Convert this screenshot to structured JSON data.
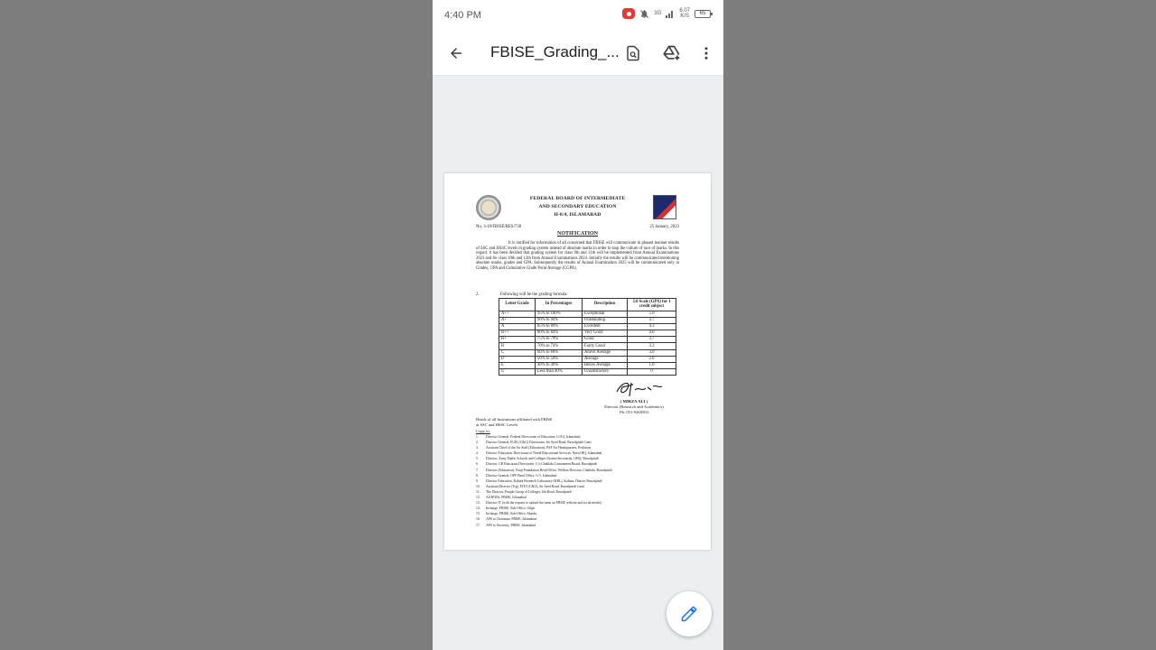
{
  "status_bar": {
    "time": "4:40 PM",
    "network": "3G",
    "speed_value": "6.07",
    "speed_unit": "K/S",
    "battery": "65"
  },
  "toolbar": {
    "title": "FBISE_Grading_...",
    "icons": [
      "back-arrow-icon",
      "find-in-page-icon",
      "drive-add-icon",
      "more-vert-icon"
    ]
  },
  "document": {
    "header_lines": [
      "FEDERAL BOARD OF INTERMEDIATE",
      "AND SECONDARY EDUCATION",
      "H-8/4, ISLAMABAD"
    ],
    "ref_no": "No. 3-19/FBISE/RES/738",
    "date": "25 January, 2023",
    "heading": "NOTIFICATION",
    "paragraph1": "It is notified for information of all concerned that FBISE will communicate in phased manner results of SSC and HSSC levels in grading system instead of absolute marks in order to stop the culture of race of marks. In this regard, it has been decided that grading system for class 9th and 11th will be implemented from Annual Examinations 2023 and for class 10th and 12th from Annual Examinations 2024. Initially the results will be communicated mentioning absolute marks, grades and GPA. Subsequently the results of Annual Examination 2025 will be communicated only in Grades, GPA and Cumulative Grade Point Average (CGPA).",
    "paragraph2_num": "2.",
    "paragraph2": "Following will be the grading formula:",
    "table": {
      "headers": [
        "Letter Grade",
        "In Percentages",
        "Description",
        "5.0 Scale (GPA) for 1 credit subject"
      ],
      "rows": [
        [
          "A++",
          "95% to 100%",
          "Exceptional",
          "5.0"
        ],
        [
          "A+",
          "90% to 94%",
          "Outstanding",
          "4.7"
        ],
        [
          "A",
          "85% to 89%",
          "Excellent",
          "4.3"
        ],
        [
          "B++",
          "80% to 84%",
          "Very Good",
          "4.0"
        ],
        [
          "B+",
          "75% to 79%",
          "Good",
          "3.7"
        ],
        [
          "B",
          "70% to 74%",
          "Fairly Good",
          "3.3"
        ],
        [
          "C",
          "60% to 69%",
          "Above Average",
          "3.0"
        ],
        [
          "D",
          "50% to 59%",
          "Average",
          "2.0"
        ],
        [
          "E",
          "40% to 49%",
          "Below Average",
          "1.0"
        ],
        [
          "U",
          "Less than 40%",
          "Unsatisfactory",
          "0"
        ]
      ]
    },
    "signatory_name": "( MIRZA ALI )",
    "signatory_designation": "Director (Research and Academics)",
    "signatory_phone": "Ph: 051-9269504",
    "addressee_line1": "Heads of all Institutions affiliated with FBISE",
    "addressee_line2": "at SSC and HSSC Levels",
    "copy_to_label": "Copy to:",
    "copy_to": [
      "Director General, Federal Directorate of Education, G-9/4, Islamabad",
      "Director General, FGEI (C&G) Directorate, Sir Syed Road, Rawalpindi Cantt",
      "Assistant Chief of the Air Staff (Education), PAF Air Headquarters, Peshawar",
      "Director Education, Directorate of Naval Educational Services, Naval HQ, Islamabad",
      "Director, Army Public Schools and Colleges System Secretariat, GHQ, Rawalpindi",
      "Director, CB Education Directorate, C/o Chaklala Cantonment Board, Rawalpindi",
      "Director (Education), Fauji Foundation Head Office, Welfare Division, Chaklala, Rawalpindi",
      "Director General, OPF Head Office, G-5, Islamabad",
      "Director Education, Kahuta Research Laboratory (KRL), Kahuta, District Rawalpindi",
      "Assistant Director (Trg), FCEI (C&G), Sir Syed Road, Rawalpindi Cantt",
      "The Director, Punjab Group of Colleges, 6th Road, Rawalpindi",
      "All HODs, FBISE, Islamabad",
      "Director IT (with the request to upload the same on FBISE website and social media)",
      "Incharge, FBISE, Sub-Office, Gilgit",
      "Incharge, FBISE, Sub-Office, Skardu",
      "APS to Chairman, FBISE, Islamabad",
      "APS to Secretary, FBISE, Islamabad"
    ]
  },
  "fab": {
    "icon": "edit-pencil-icon",
    "color": "#1a73e8"
  },
  "colors": {
    "accent": "#1a73e8",
    "viewer_bg": "#eceff1",
    "side_bg": "#7d7d7d"
  }
}
